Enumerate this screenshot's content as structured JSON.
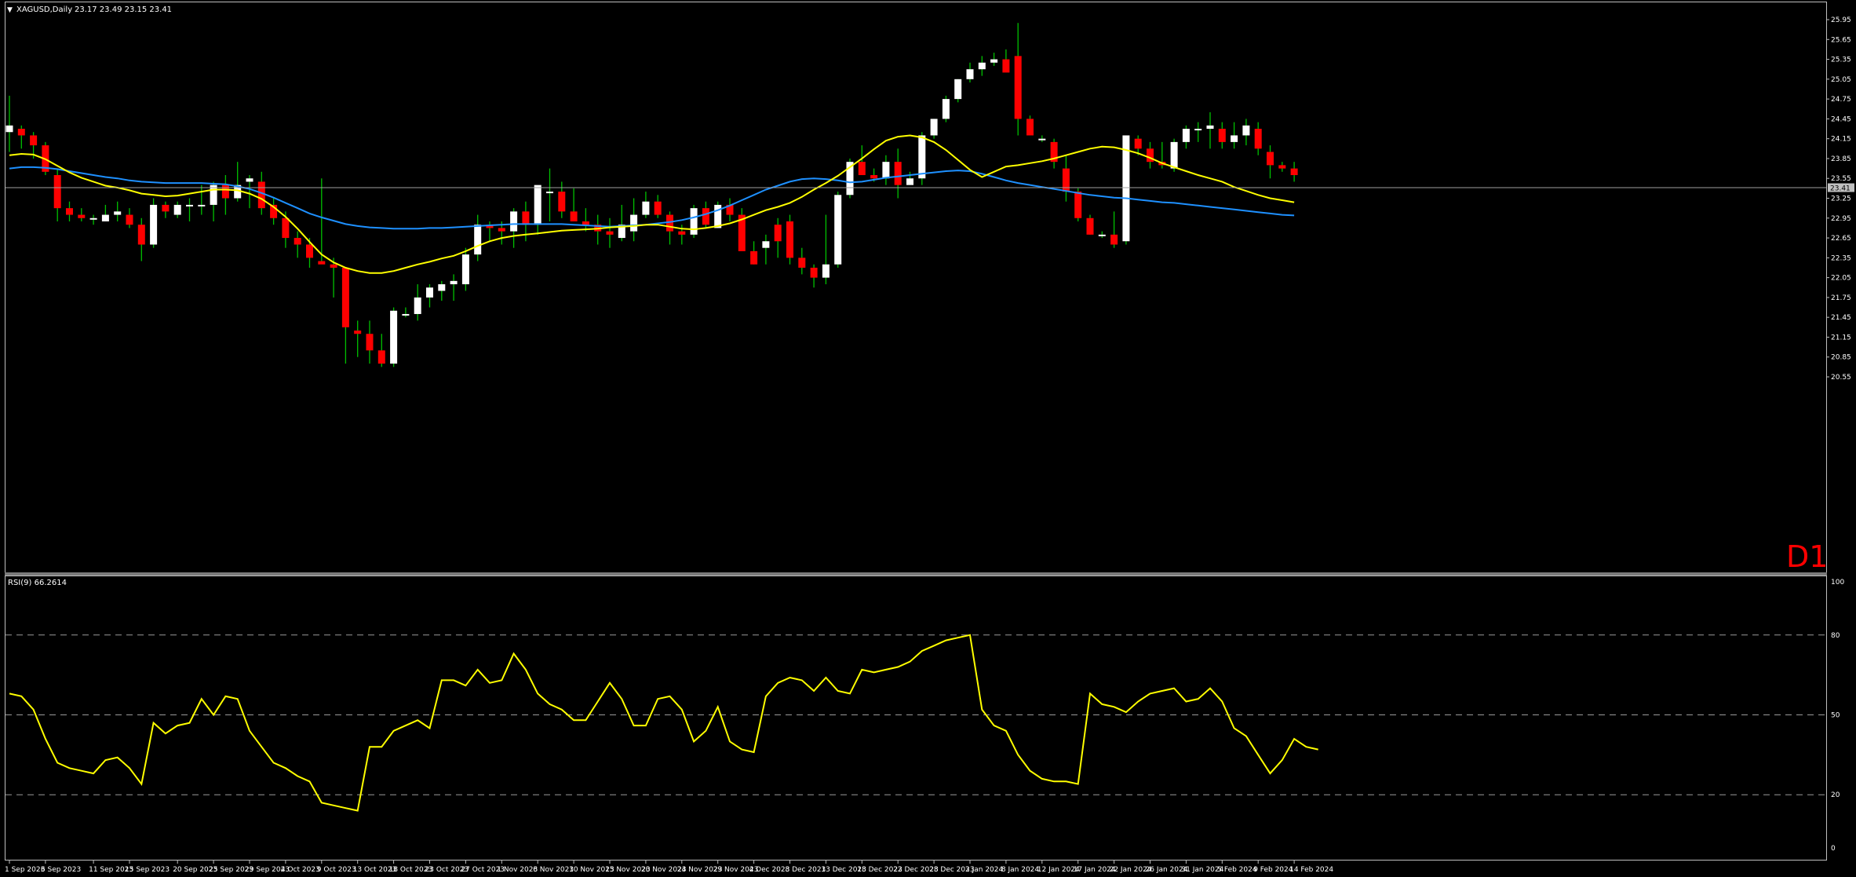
{
  "header": {
    "symbol_label": "XAGUSD,Daily",
    "ohlc_label": "23.17 23.49 23.15 23.41"
  },
  "timeframe_badge": "D1",
  "price_tag": "23.41",
  "rsi_header": "RSI(9) 66.2614",
  "colors": {
    "background": "#000000",
    "frame": "#bfbfbf",
    "bull_body": "#ffffff",
    "bear_body": "#ff0000",
    "wick": "#00c000",
    "ma_fast": "#ffff00",
    "ma_slow": "#1e90ff",
    "rsi_line": "#ffff00",
    "bid_line": "#a0a0a0",
    "badge": "#ff0000"
  },
  "chart_data": [
    {
      "type": "candlestick",
      "price_axis_ticks": [
        "25.95",
        "25.65",
        "25.35",
        "25.05",
        "24.75",
        "24.45",
        "24.15",
        "23.85",
        "23.55",
        "23.25",
        "22.95",
        "22.65",
        "22.35",
        "22.05",
        "21.75",
        "21.45",
        "21.15",
        "20.85",
        "20.55"
      ],
      "ylim": [
        20.55,
        26.25
      ],
      "x_ticks": [
        "1 Sep 2023",
        "6 Sep 2023",
        "11 Sep 2023",
        "15 Sep 2023",
        "20 Sep 2023",
        "25 Sep 2023",
        "29 Sep 2023",
        "4 Oct 2023",
        "9 Oct 2023",
        "13 Oct 2023",
        "18 Oct 2023",
        "23 Oct 2023",
        "27 Oct 2023",
        "1 Nov 2023",
        "6 Nov 2023",
        "10 Nov 2023",
        "15 Nov 2023",
        "20 Nov 2023",
        "24 Nov 2023",
        "29 Nov 2023",
        "4 Dec 2023",
        "8 Dec 2023",
        "13 Dec 2023",
        "18 Dec 2023",
        "22 Dec 2023",
        "28 Dec 2023",
        "3 Jan 2024",
        "8 Jan 2024",
        "12 Jan 2024",
        "17 Jan 2024",
        "22 Jan 2024",
        "26 Jan 2024",
        "31 Jan 2024",
        "5 Feb 2024",
        "9 Feb 2024",
        "14 Feb 2024"
      ],
      "x_tick_index": [
        0,
        3,
        7,
        10,
        14,
        17,
        20,
        23,
        26,
        29,
        32,
        35,
        38,
        41,
        44,
        47,
        50,
        53,
        56,
        59,
        62,
        65,
        68,
        71,
        74,
        77,
        80,
        83,
        86,
        89,
        92,
        95,
        98,
        101,
        104,
        107
      ],
      "ohlc": [
        [
          24.25,
          24.8,
          23.95,
          24.35
        ],
        [
          24.3,
          24.35,
          24.0,
          24.2
        ],
        [
          24.2,
          24.25,
          23.85,
          24.05
        ],
        [
          24.05,
          24.1,
          23.6,
          23.65
        ],
        [
          23.6,
          23.7,
          22.9,
          23.1
        ],
        [
          23.1,
          23.2,
          22.9,
          23.0
        ],
        [
          23.0,
          23.1,
          22.9,
          22.95
        ],
        [
          22.95,
          23.0,
          22.85,
          22.95
        ],
        [
          22.9,
          23.15,
          22.9,
          23.0
        ],
        [
          23.0,
          23.2,
          22.9,
          23.05
        ],
        [
          23.0,
          23.1,
          22.8,
          22.85
        ],
        [
          22.85,
          22.95,
          22.3,
          22.55
        ],
        [
          22.55,
          23.25,
          22.5,
          23.15
        ],
        [
          23.15,
          23.2,
          22.95,
          23.05
        ],
        [
          23.0,
          23.2,
          22.95,
          23.15
        ],
        [
          23.15,
          23.25,
          22.9,
          23.15
        ],
        [
          23.15,
          23.45,
          23.0,
          23.15
        ],
        [
          23.15,
          23.5,
          22.9,
          23.45
        ],
        [
          23.45,
          23.6,
          23.0,
          23.25
        ],
        [
          23.25,
          23.8,
          23.2,
          23.45
        ],
        [
          23.5,
          23.6,
          23.1,
          23.55
        ],
        [
          23.5,
          23.65,
          23.0,
          23.1
        ],
        [
          23.15,
          23.25,
          22.85,
          22.95
        ],
        [
          22.95,
          23.05,
          22.5,
          22.65
        ],
        [
          22.65,
          22.75,
          22.35,
          22.55
        ],
        [
          22.55,
          22.65,
          22.2,
          22.35
        ],
        [
          22.3,
          23.55,
          22.3,
          22.25
        ],
        [
          22.25,
          22.35,
          21.75,
          22.2
        ],
        [
          22.2,
          22.2,
          20.75,
          21.3
        ],
        [
          21.25,
          21.4,
          20.85,
          21.2
        ],
        [
          21.2,
          21.4,
          20.75,
          20.95
        ],
        [
          20.95,
          21.2,
          20.7,
          20.75
        ],
        [
          20.75,
          21.6,
          20.7,
          21.55
        ],
        [
          21.5,
          21.6,
          21.45,
          21.5
        ],
        [
          21.5,
          21.95,
          21.4,
          21.75
        ],
        [
          21.75,
          21.95,
          21.6,
          21.9
        ],
        [
          21.85,
          22.0,
          21.7,
          21.95
        ],
        [
          21.95,
          22.1,
          21.7,
          22.0
        ],
        [
          21.95,
          22.5,
          21.85,
          22.4
        ],
        [
          22.4,
          23.0,
          22.3,
          22.85
        ],
        [
          22.85,
          22.9,
          22.6,
          22.8
        ],
        [
          22.8,
          22.9,
          22.55,
          22.75
        ],
        [
          22.75,
          23.1,
          22.5,
          23.05
        ],
        [
          23.05,
          23.2,
          22.6,
          22.85
        ],
        [
          22.85,
          23.4,
          22.7,
          23.45
        ],
        [
          23.35,
          23.7,
          22.9,
          23.35
        ],
        [
          23.35,
          23.5,
          22.95,
          23.05
        ],
        [
          23.05,
          23.4,
          22.9,
          22.9
        ],
        [
          22.9,
          23.1,
          22.75,
          22.85
        ],
        [
          22.85,
          23.0,
          22.55,
          22.75
        ],
        [
          22.75,
          22.95,
          22.5,
          22.7
        ],
        [
          22.65,
          23.15,
          22.6,
          22.85
        ],
        [
          22.75,
          23.25,
          22.6,
          23.0
        ],
        [
          23.0,
          23.35,
          22.95,
          23.2
        ],
        [
          23.2,
          23.3,
          22.95,
          23.0
        ],
        [
          23.0,
          23.05,
          22.55,
          22.75
        ],
        [
          22.75,
          22.85,
          22.55,
          22.7
        ],
        [
          22.7,
          23.15,
          22.65,
          23.1
        ],
        [
          23.1,
          23.2,
          22.8,
          22.85
        ],
        [
          22.8,
          23.2,
          22.8,
          23.15
        ],
        [
          23.15,
          23.25,
          22.9,
          23.0
        ],
        [
          23.0,
          23.1,
          22.5,
          22.45
        ],
        [
          22.45,
          22.6,
          22.25,
          22.25
        ],
        [
          22.5,
          22.7,
          22.25,
          22.6
        ],
        [
          22.85,
          22.95,
          22.35,
          22.6
        ],
        [
          22.9,
          23.0,
          22.25,
          22.35
        ],
        [
          22.35,
          22.5,
          22.1,
          22.2
        ],
        [
          22.2,
          22.25,
          21.9,
          22.05
        ],
        [
          22.05,
          23.0,
          21.95,
          22.25
        ],
        [
          22.25,
          23.35,
          22.2,
          23.3
        ],
        [
          23.3,
          23.85,
          23.25,
          23.8
        ],
        [
          23.8,
          24.05,
          23.65,
          23.6
        ],
        [
          23.6,
          23.7,
          23.5,
          23.55
        ],
        [
          23.55,
          23.9,
          23.45,
          23.8
        ],
        [
          23.8,
          24.0,
          23.25,
          23.45
        ],
        [
          23.45,
          23.65,
          23.45,
          23.55
        ],
        [
          23.55,
          24.25,
          23.45,
          24.2
        ],
        [
          24.2,
          24.45,
          24.15,
          24.45
        ],
        [
          24.45,
          24.8,
          24.4,
          24.75
        ],
        [
          24.75,
          25.05,
          24.7,
          25.05
        ],
        [
          25.05,
          25.3,
          25.0,
          25.2
        ],
        [
          25.2,
          25.4,
          25.1,
          25.3
        ],
        [
          25.3,
          25.45,
          25.25,
          25.35
        ],
        [
          25.35,
          25.5,
          25.2,
          25.15
        ],
        [
          25.4,
          25.9,
          24.2,
          24.45
        ],
        [
          24.45,
          24.5,
          24.2,
          24.2
        ],
        [
          24.15,
          24.2,
          24.1,
          24.15
        ],
        [
          24.1,
          24.15,
          23.7,
          23.8
        ],
        [
          23.7,
          23.9,
          23.2,
          23.35
        ],
        [
          23.35,
          23.4,
          22.9,
          22.95
        ],
        [
          22.95,
          23.0,
          22.7,
          22.7
        ],
        [
          22.7,
          22.75,
          22.65,
          22.7
        ],
        [
          22.7,
          23.05,
          22.5,
          22.55
        ],
        [
          22.6,
          24.2,
          22.55,
          24.2
        ],
        [
          24.15,
          24.2,
          23.9,
          24.0
        ],
        [
          24.0,
          24.1,
          23.7,
          23.8
        ],
        [
          23.8,
          24.1,
          23.7,
          23.75
        ],
        [
          23.7,
          24.15,
          23.65,
          24.1
        ],
        [
          24.1,
          24.35,
          24.0,
          24.3
        ],
        [
          24.3,
          24.4,
          24.1,
          24.3
        ],
        [
          24.3,
          24.55,
          24.0,
          24.35
        ],
        [
          24.3,
          24.4,
          24.0,
          24.1
        ],
        [
          24.1,
          24.4,
          24.0,
          24.2
        ],
        [
          24.2,
          24.45,
          24.05,
          24.35
        ],
        [
          24.3,
          24.4,
          23.9,
          24.0
        ],
        [
          23.95,
          24.05,
          23.55,
          23.75
        ],
        [
          23.75,
          23.8,
          23.65,
          23.7
        ],
        [
          23.7,
          23.8,
          23.5,
          23.6
        ]
      ],
      "ma_fast_values": [
        23.9,
        23.92,
        23.91,
        23.84,
        23.74,
        23.64,
        23.56,
        23.5,
        23.44,
        23.41,
        23.37,
        23.32,
        23.3,
        23.28,
        23.29,
        23.32,
        23.35,
        23.38,
        23.38,
        23.37,
        23.32,
        23.24,
        23.12,
        22.97,
        22.79,
        22.59,
        22.4,
        22.28,
        22.2,
        22.15,
        22.12,
        22.12,
        22.15,
        22.2,
        22.25,
        22.29,
        22.34,
        22.38,
        22.45,
        22.53,
        22.6,
        22.65,
        22.68,
        22.7,
        22.72,
        22.74,
        22.76,
        22.77,
        22.78,
        22.79,
        22.81,
        22.82,
        22.83,
        22.85,
        22.85,
        22.82,
        22.79,
        22.78,
        22.8,
        22.83,
        22.87,
        22.93,
        23.0,
        23.07,
        23.12,
        23.18,
        23.27,
        23.38,
        23.48,
        23.59,
        23.72,
        23.85,
        23.99,
        24.12,
        24.18,
        24.2,
        24.17,
        24.1,
        23.98,
        23.83,
        23.68,
        23.57,
        23.65,
        23.73,
        23.75,
        23.78,
        23.81,
        23.85,
        23.9,
        23.95,
        24.0,
        24.03,
        24.02,
        23.98,
        23.93,
        23.86,
        23.78,
        23.72,
        23.66,
        23.6,
        23.55,
        23.5,
        23.42,
        23.36,
        23.3,
        23.25,
        23.22,
        23.19
      ],
      "ma_slow_values": [
        23.7,
        23.72,
        23.72,
        23.71,
        23.69,
        23.66,
        23.63,
        23.6,
        23.57,
        23.55,
        23.52,
        23.5,
        23.49,
        23.48,
        23.48,
        23.48,
        23.48,
        23.47,
        23.46,
        23.43,
        23.39,
        23.33,
        23.26,
        23.18,
        23.1,
        23.02,
        22.96,
        22.91,
        22.86,
        22.83,
        22.81,
        22.8,
        22.79,
        22.79,
        22.79,
        22.8,
        22.8,
        22.81,
        22.82,
        22.83,
        22.84,
        22.85,
        22.86,
        22.86,
        22.86,
        22.86,
        22.86,
        22.85,
        22.84,
        22.83,
        22.82,
        22.83,
        22.84,
        22.85,
        22.87,
        22.89,
        22.92,
        22.96,
        23.01,
        23.07,
        23.14,
        23.22,
        23.3,
        23.38,
        23.44,
        23.5,
        23.54,
        23.55,
        23.54,
        23.52,
        23.49,
        23.5,
        23.53,
        23.56,
        23.58,
        23.6,
        23.62,
        23.64,
        23.66,
        23.67,
        23.66,
        23.62,
        23.57,
        23.52,
        23.48,
        23.45,
        23.42,
        23.39,
        23.36,
        23.33,
        23.3,
        23.28,
        23.26,
        23.25,
        23.23,
        23.21,
        23.19,
        23.18,
        23.16,
        23.14,
        23.12,
        23.1,
        23.08,
        23.06,
        23.04,
        23.02,
        23.0,
        22.99
      ],
      "bid_price": 23.41
    },
    {
      "type": "line",
      "name": "RSI(9)",
      "ylim": [
        0,
        100
      ],
      "y_ticks": [
        "100",
        "80",
        "50",
        "20",
        "0"
      ],
      "levels": [
        80,
        50,
        20
      ],
      "values": [
        58,
        57,
        52,
        41,
        32,
        30,
        29,
        28,
        33,
        34,
        30,
        24,
        47,
        43,
        46,
        47,
        56,
        50,
        57,
        56,
        44,
        38,
        32,
        30,
        27,
        25,
        17,
        16,
        15,
        14,
        38,
        38,
        44,
        46,
        48,
        45,
        63,
        63,
        61,
        67,
        62,
        63,
        73,
        67,
        58,
        54,
        52,
        48,
        48,
        55,
        62,
        56,
        46,
        46,
        56,
        57,
        52,
        40,
        44,
        53,
        40,
        37,
        36,
        57,
        62,
        64,
        63,
        59,
        64,
        59,
        58,
        67,
        66,
        67,
        68,
        70,
        74,
        76,
        78,
        79,
        80,
        52,
        46,
        44,
        35,
        29,
        26,
        25,
        25,
        24,
        58,
        54,
        53,
        51,
        55,
        58,
        59,
        60,
        55,
        56,
        60,
        55,
        45,
        42,
        35,
        28,
        33,
        41,
        38,
        37
      ]
    }
  ]
}
